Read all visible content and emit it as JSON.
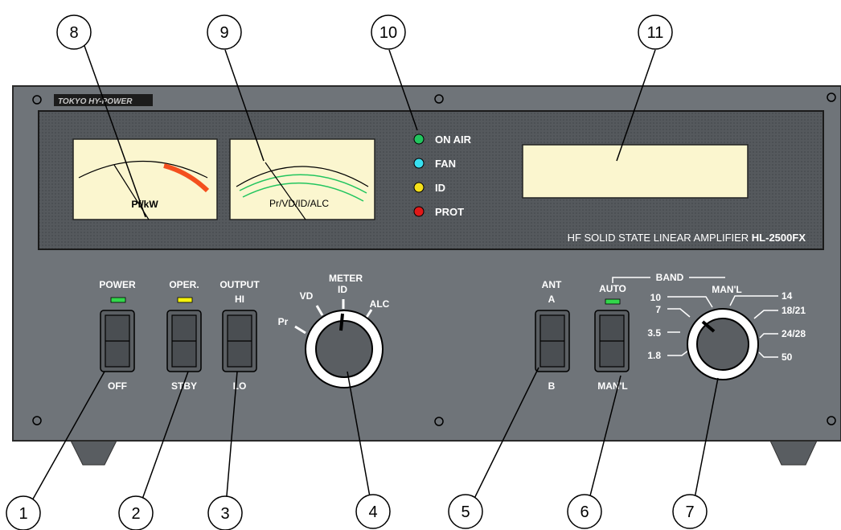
{
  "brand": "TOKYO HY-POWER",
  "callouts": [
    "1",
    "2",
    "3",
    "4",
    "5",
    "6",
    "7",
    "8",
    "9",
    "10",
    "11"
  ],
  "meters": {
    "left_label": "Pf/kW",
    "right_label": "Pr/VD/ID/ALC"
  },
  "leds": [
    {
      "label": "ON AIR",
      "color": "#22c55e"
    },
    {
      "label": "FAN",
      "color": "#38e0f0"
    },
    {
      "label": "ID",
      "color": "#f5e11a"
    },
    {
      "label": "PROT",
      "color": "#e01818"
    }
  ],
  "model_text": {
    "prefix": "HF SOLID STATE LINEAR AMPLIFIER ",
    "model": "HL-2500FX"
  },
  "switches": {
    "power": {
      "top": "POWER",
      "bottom": "OFF"
    },
    "oper": {
      "top": "OPER.",
      "bottom": "STBY"
    },
    "output": {
      "top1": "OUTPUT",
      "top2": "HI",
      "bottom": "LO"
    },
    "ant": {
      "top1": "ANT",
      "top2": "A",
      "bottom": "B"
    },
    "auto": {
      "top": "AUTO",
      "bottom": "MAN'L"
    }
  },
  "meter_knob": {
    "title": "METER",
    "positions": [
      "Pr",
      "VD",
      "ID",
      "ALC"
    ]
  },
  "band": {
    "title": "BAND",
    "manl": "MAN'L",
    "left": [
      "10",
      "7",
      "3.5",
      "1.8"
    ],
    "right": [
      "14",
      "18/21",
      "24/28",
      "50"
    ]
  },
  "colors": {
    "panel": "#6f7479",
    "window": "#55595d",
    "meter_face": "#fbf6cf",
    "led_green": "#32d74b",
    "led_yellow": "#f6f20c"
  }
}
